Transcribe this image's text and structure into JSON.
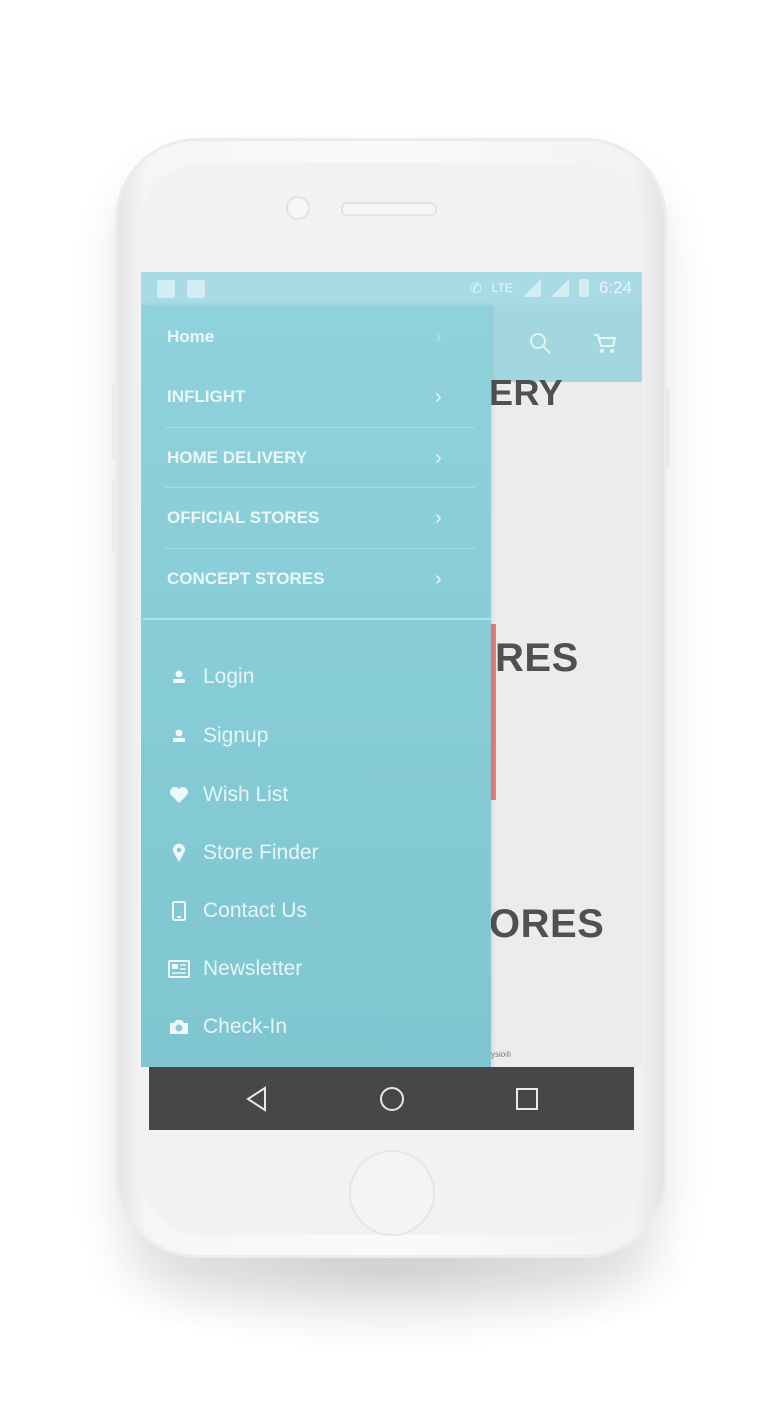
{
  "status_bar": {
    "network": "LTE",
    "time": "6:24"
  },
  "background_content": {
    "word_1": "ERY",
    "word_2": "RES",
    "word_3": "ORES",
    "credit": "ysio®"
  },
  "drawer": {
    "categories": [
      {
        "label": "Home",
        "icon": "chevron-right-icon"
      },
      {
        "label": "INFLIGHT",
        "icon": "chevron-right-icon"
      },
      {
        "label": "HOME DELIVERY",
        "icon": "chevron-right-icon"
      },
      {
        "label": "OFFICIAL STORES",
        "icon": "chevron-right-icon"
      },
      {
        "label": "CONCEPT STORES",
        "icon": "chevron-right-icon"
      }
    ],
    "links": [
      {
        "label": "Login",
        "icon": "user-icon"
      },
      {
        "label": "Signup",
        "icon": "user-icon"
      },
      {
        "label": "Wish List",
        "icon": "heart-icon"
      },
      {
        "label": "Store Finder",
        "icon": "map-pin-icon"
      },
      {
        "label": "Contact Us",
        "icon": "phone-icon"
      },
      {
        "label": "Newsletter",
        "icon": "newspaper-icon"
      },
      {
        "label": "Check-In",
        "icon": "camera-icon"
      }
    ],
    "chevron": "›"
  },
  "nav_bar": {
    "back": "back-icon",
    "home": "home-icon",
    "recents": "recents-icon"
  },
  "colors": {
    "drawer": "#88cdd7",
    "header": "#a3d7df",
    "status_bar": "#a8dbe3",
    "nav_bar": "#474747"
  }
}
